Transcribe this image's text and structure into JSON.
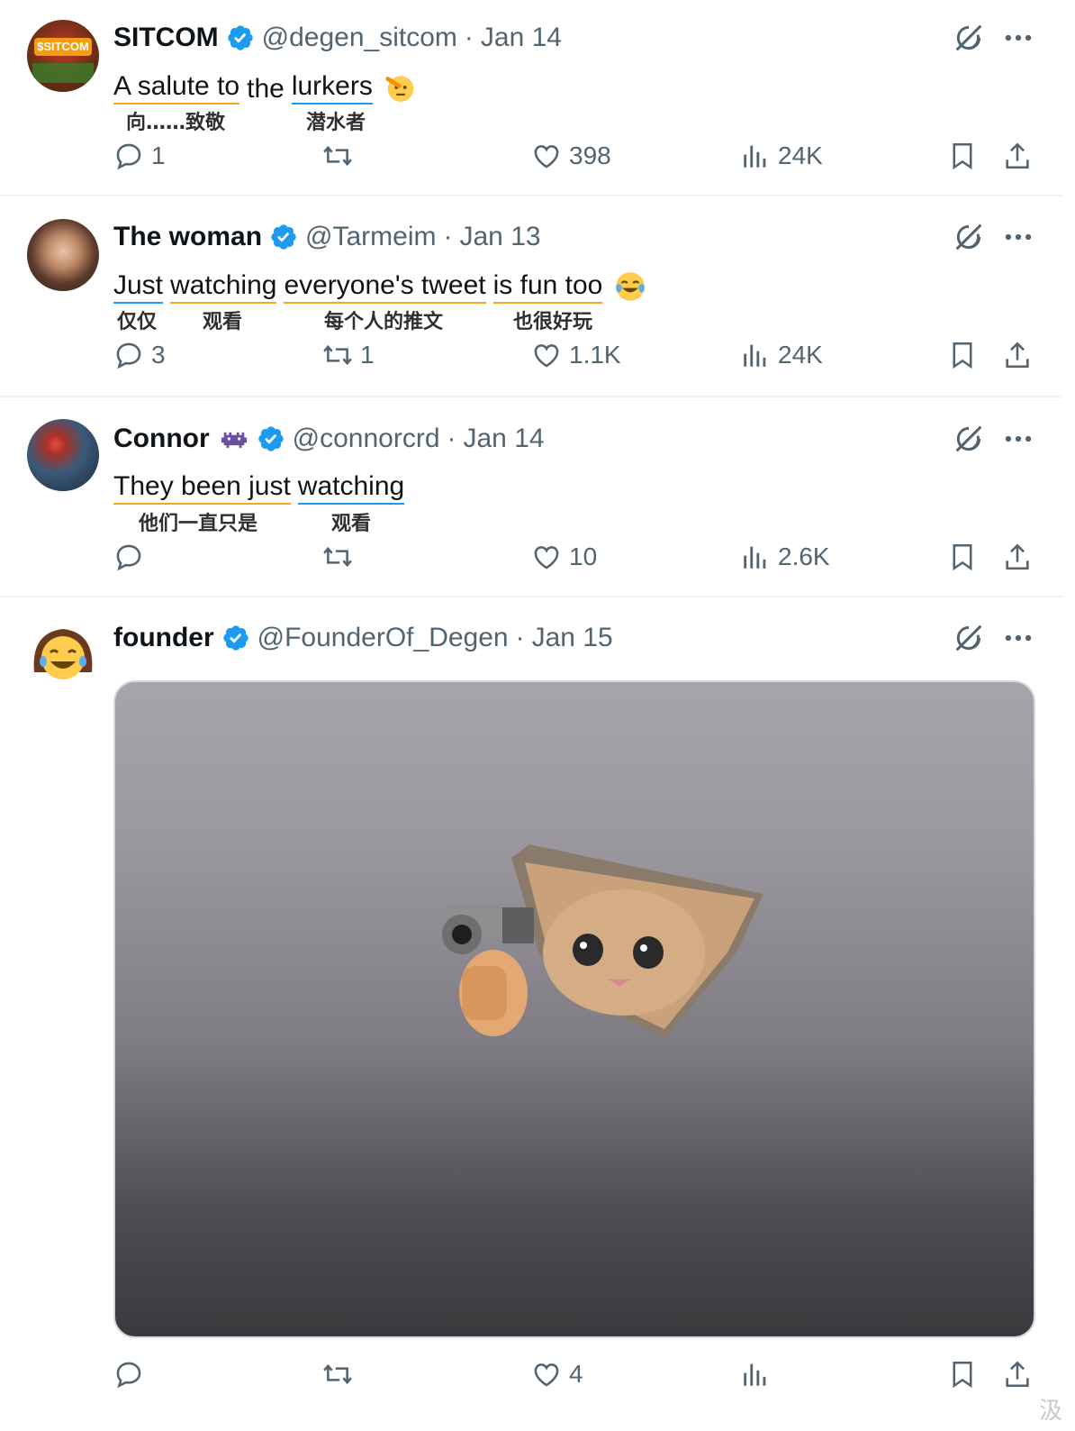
{
  "tweets": [
    {
      "name": "SITCOM",
      "handle": "@degen_sitcom",
      "date": "Jan 14",
      "text_words": [
        "A salute to",
        "the",
        "lurkers"
      ],
      "translations": [
        "向……致敬",
        "潜水者"
      ],
      "stats": {
        "replies": "1",
        "retweets": "",
        "likes": "398",
        "views": "24K"
      },
      "avatar_label": "$SITCOM"
    },
    {
      "name": "The woman",
      "handle": "@Tarmeim",
      "date": "Jan 13",
      "text_words": [
        "Just",
        "watching",
        "everyone's tweet",
        "is fun too"
      ],
      "translations": [
        "仅仅",
        "观看",
        "每个人的推文",
        "也很好玩"
      ],
      "stats": {
        "replies": "3",
        "retweets": "1",
        "likes": "1.1K",
        "views": "24K"
      }
    },
    {
      "name": "Connor",
      "handle": "@connorcrd",
      "date": "Jan 14",
      "text_words": [
        "They been just",
        "watching"
      ],
      "translations": [
        "他们一直只是",
        "观看"
      ],
      "stats": {
        "replies": "",
        "retweets": "",
        "likes": "10",
        "views": "2.6K"
      }
    },
    {
      "name": "founder",
      "handle": "@FounderOf_Degen",
      "date": "Jan 15",
      "stats": {
        "replies": "",
        "retweets": "",
        "likes": "4",
        "views": ""
      }
    }
  ],
  "separator": "·",
  "watermark": "汲",
  "icons": {
    "verified": "verified-badge-icon",
    "grok": "grok-icon",
    "more": "more-options-icon",
    "reply": "reply-icon",
    "retweet": "retweet-icon",
    "like": "heart-icon",
    "views": "views-chart-icon",
    "bookmark": "bookmark-icon",
    "share": "share-icon"
  },
  "colors": {
    "accent": "#1d9bf0",
    "muted": "#536471",
    "underline_orange": "#f5a623"
  }
}
